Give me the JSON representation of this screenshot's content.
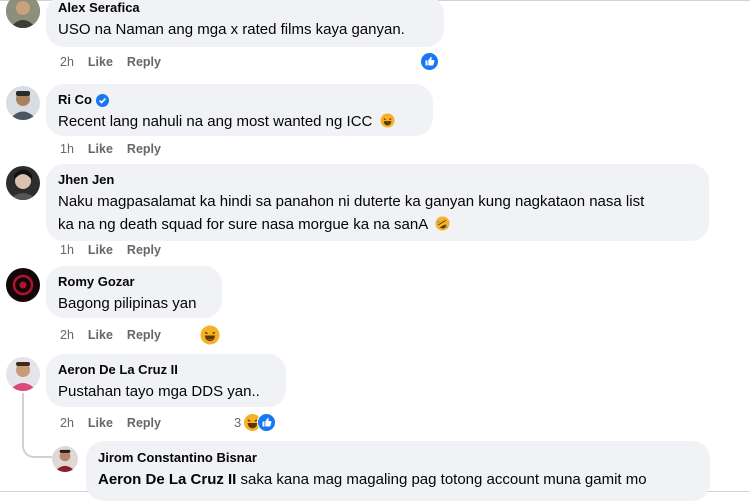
{
  "comments": [
    {
      "author": "Alex Serafica",
      "text": "USO na Naman ang mga x rated films kaya ganyan.",
      "time": "2h",
      "like": "Like",
      "reply": "Reply",
      "reactions": [
        "like"
      ]
    },
    {
      "author": "Ri Co",
      "verified": true,
      "text": "Recent lang nahuli na ang most wanted ng ICC",
      "time": "1h",
      "like": "Like",
      "reply": "Reply"
    },
    {
      "author": "Jhen Jen",
      "text_line1": "Naku magpasalamat ka hindi sa panahon ni duterte ka ganyan kung nagkataon nasa list",
      "text_line2": "ka na ng death squad for sure nasa morgue ka na sanA",
      "time": "1h",
      "like": "Like",
      "reply": "Reply"
    },
    {
      "author": "Romy Gozar",
      "text": "Bagong pilipinas yan",
      "time": "2h",
      "like": "Like",
      "reply": "Reply",
      "reactions": [
        "haha"
      ]
    },
    {
      "author": "Aeron De La Cruz II",
      "text": "Pustahan tayo mga DDS yan..",
      "time": "2h",
      "like": "Like",
      "reply": "Reply",
      "reaction_count": "3",
      "reactions": [
        "haha",
        "like"
      ]
    }
  ],
  "reply": {
    "author": "Jirom Constantino Bisnar",
    "mention": "Aeron De La Cruz II",
    "text": " saka kana mag magaling pag totong account muna gamit mo"
  },
  "colors": {
    "bubble": "#f0f2f5",
    "meta": "#65676b",
    "like_blue": "#1877f2",
    "haha_yellow": "#f7b125"
  }
}
